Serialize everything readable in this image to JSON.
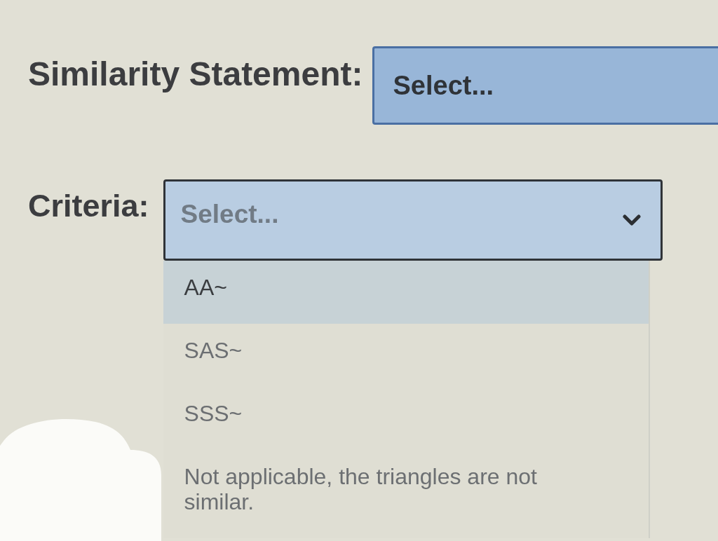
{
  "similarity_statement": {
    "label": "Similarity Statement:",
    "placeholder": "Select...",
    "expanded": false
  },
  "criteria": {
    "label": "Criteria:",
    "placeholder": "Select...",
    "expanded": true,
    "options": [
      {
        "label": "AA~",
        "highlighted": true
      },
      {
        "label": "SAS~",
        "highlighted": false
      },
      {
        "label": "SSS~",
        "highlighted": false
      },
      {
        "label": "Not applicable, the triangles are not similar.",
        "highlighted": false
      }
    ]
  }
}
